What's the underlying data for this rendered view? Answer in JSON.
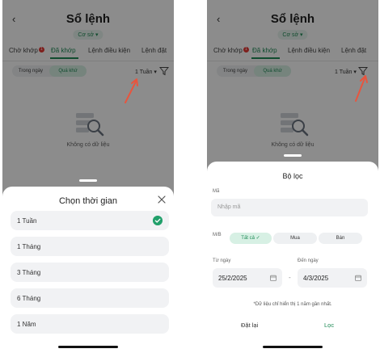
{
  "header": {
    "back_icon": "chevron-left-icon",
    "title": "Sổ lệnh",
    "account": "Cơ sở"
  },
  "tabs": [
    {
      "label": "Chờ khớp",
      "badge": "1"
    },
    {
      "label": "Đã khớp",
      "active": true
    },
    {
      "label": "Lệnh điều kiện"
    },
    {
      "label": "Lệnh đặt"
    }
  ],
  "segment": {
    "items": [
      "Trong ngày",
      "Quá khứ"
    ],
    "selected": "Quá khứ"
  },
  "period_selector": "1 Tuần",
  "empty_state": {
    "icon": "document-search-icon",
    "text": "Không có dữ liệu"
  },
  "time_sheet": {
    "title": "Chọn thời gian",
    "close_icon": "close-icon",
    "options": [
      "1 Tuần",
      "1 Tháng",
      "3 Tháng",
      "6 Tháng",
      "1 Năm"
    ],
    "selected": "1 Tuần"
  },
  "filter_sheet": {
    "title": "Bộ lọc",
    "code_label": "Mã",
    "code_placeholder": "Nhập mã",
    "side_label": "M/B",
    "side_options": [
      "Tất cả",
      "Mua",
      "Bán"
    ],
    "side_selected": "Tất cả",
    "from_label": "Từ ngày",
    "from_date": "25/2/2025",
    "to_label": "Đến ngày",
    "to_date": "4/3/2025",
    "date_separator": "-",
    "note": "*Dữ liệu chỉ hiển thị 1 năm gần nhất.",
    "reset_label": "Đặt lại",
    "apply_label": "Lọc"
  },
  "colors": {
    "accent": "#1f8b57",
    "accent_bg": "#d7f0e4",
    "annotation_arrow": "#e8553e",
    "badge": "#e53935"
  }
}
